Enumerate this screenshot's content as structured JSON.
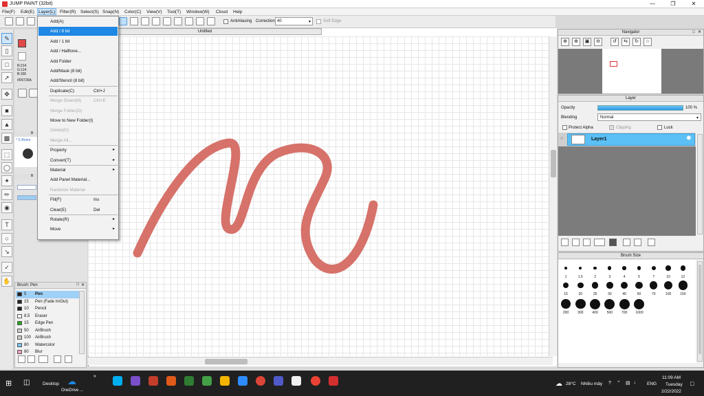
{
  "window": {
    "title": "JUMP PAINT (32bit)"
  },
  "menubar": {
    "items": [
      "File(F)",
      "Edit(E)",
      "Layer(L)",
      "Filter(R)",
      "Select(S)",
      "Snap(N)",
      "Color(C)",
      "View(V)",
      "Tool(T)",
      "Window(W)",
      "Cloud",
      "Help"
    ]
  },
  "toolbar": {
    "antialias_label": "AntiAliasing",
    "correction_label": "Correction",
    "correction_value": "40",
    "soft_edge_label": "Soft Edge"
  },
  "document": {
    "tab_title": "Untitled"
  },
  "color": {
    "r": "R:214",
    "g": "G:114",
    "b": "B:106",
    "hex": "#D6726A",
    "fg_hex": "#e04a4a",
    "stroke_hex": "#d6726a"
  },
  "brush_subpanel": {
    "size_label": "* 0.36mm",
    "label_b": "B",
    "label_b2": "B"
  },
  "brush_panel": {
    "title": "Brush: Pen",
    "items": [
      {
        "size": "5",
        "name": "Pen",
        "color": "#222222"
      },
      {
        "size": "15",
        "name": "Pen (Fade In/Out)",
        "color": "#222222"
      },
      {
        "size": "10",
        "name": "Pencil",
        "color": "#222222"
      },
      {
        "size": "8.5",
        "name": "Eraser",
        "color": "#ffffff"
      },
      {
        "size": "15",
        "name": "Edge Pen",
        "color": "#22aa22"
      },
      {
        "size": "50",
        "name": "AirBrush",
        "color": "#cccccc"
      },
      {
        "size": "100",
        "name": "AirBrush",
        "color": "#cccccc"
      },
      {
        "size": "80",
        "name": "Watercolor",
        "color": "#7ac4ee"
      },
      {
        "size": "80",
        "name": "Blur",
        "color": "#f0a0c0"
      }
    ]
  },
  "layer_menu": {
    "items": [
      {
        "label": "Add(A)",
        "shortcut": "",
        "disabled": false,
        "arrow": false
      },
      {
        "label": "Add / 8 bit",
        "shortcut": "",
        "disabled": false,
        "arrow": false
      },
      {
        "label": "Add / 1 bit",
        "shortcut": "",
        "disabled": false,
        "arrow": false
      },
      {
        "label": "Add / Halftone...",
        "shortcut": "",
        "disabled": false,
        "arrow": false
      },
      {
        "label": "Add Folder",
        "shortcut": "",
        "disabled": false,
        "arrow": false
      },
      {
        "label": "Add/Mask (8 bit)",
        "shortcut": "",
        "disabled": false,
        "arrow": false
      },
      {
        "label": "Add/Stencil (8 bit)",
        "shortcut": "",
        "disabled": false,
        "arrow": false
      },
      {
        "label": "Duplicate(C)",
        "shortcut": "Ctrl+J",
        "disabled": false,
        "arrow": false
      },
      {
        "label": "Merge Down(M)",
        "shortcut": "Ctrl+E",
        "disabled": true,
        "arrow": false
      },
      {
        "label": "Merge Folder(O)",
        "shortcut": "",
        "disabled": true,
        "arrow": false
      },
      {
        "label": "Move to New Folder(I)",
        "shortcut": "",
        "disabled": false,
        "arrow": false
      },
      {
        "label": "Delete(D)",
        "shortcut": "",
        "disabled": true,
        "arrow": false
      },
      {
        "label": "Merge All...",
        "shortcut": "",
        "disabled": true,
        "arrow": false
      },
      {
        "label": "Property",
        "shortcut": "",
        "disabled": false,
        "arrow": true
      },
      {
        "label": "Convert(T)",
        "shortcut": "",
        "disabled": false,
        "arrow": true
      },
      {
        "label": "Material",
        "shortcut": "",
        "disabled": false,
        "arrow": true
      },
      {
        "label": "Add Panel Material...",
        "shortcut": "",
        "disabled": false,
        "arrow": false
      },
      {
        "label": "Rasterize Material",
        "shortcut": "",
        "disabled": true,
        "arrow": false
      },
      {
        "label": "Fill(F)",
        "shortcut": "Ins",
        "disabled": false,
        "arrow": false
      },
      {
        "label": "Clear(E)",
        "shortcut": "Del",
        "disabled": false,
        "arrow": false
      },
      {
        "label": "Rotate(R)",
        "shortcut": "",
        "disabled": false,
        "arrow": true
      },
      {
        "label": "Move",
        "shortcut": "",
        "disabled": false,
        "arrow": true
      }
    ],
    "highlighted_index": 1
  },
  "navigator": {
    "title": "Navigator"
  },
  "layer_panel": {
    "title": "Layer",
    "opacity_label": "Opacity",
    "opacity_value": "100 %",
    "opacity_fraction": 1.0,
    "blending_label": "Blending",
    "blending_value": "Normal",
    "protect_alpha_label": "Protect Alpha",
    "clipping_label": "Clipping",
    "lock_label": "Lock",
    "layer_name": "Layer1"
  },
  "brush_size_panel": {
    "title": "Brush Size",
    "sizes": [
      "1",
      "1.5",
      "2",
      "3",
      "4",
      "5",
      "7",
      "10",
      "12",
      "15",
      "20",
      "25",
      "30",
      "40",
      "50",
      "70",
      "100",
      "150",
      "200",
      "300",
      "400",
      "500",
      "700",
      "1000"
    ]
  },
  "taskbar": {
    "desktop_label": "Desktop",
    "onedrive_label": "OneDrive ...",
    "weather_temp": "28°C",
    "weather_text": "Nhiều mây",
    "language": "ENG",
    "time": "11:09 AM",
    "day": "Tuesday",
    "date": "2/22/2022"
  },
  "icons": [
    "pen-icon",
    "eraser-icon",
    "select-icon",
    "line-icon",
    "move-icon",
    "fill-icon",
    "gradient-icon",
    "text-icon",
    "eyedropper-icon",
    "hand-icon",
    "zoom-in-icon",
    "zoom-out-icon",
    "gear-icon",
    "folder-icon",
    "trash-icon"
  ]
}
